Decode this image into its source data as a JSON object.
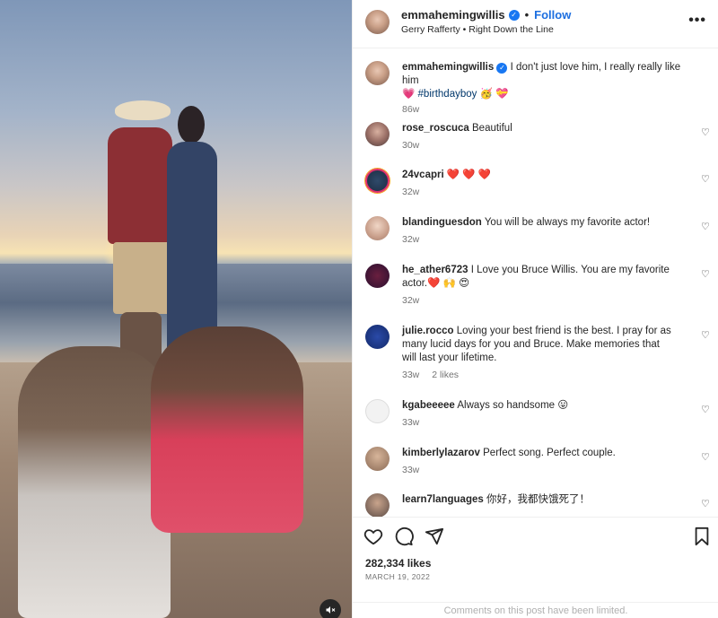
{
  "post": {
    "username": "emmahemingwillis",
    "follow_label": "Follow",
    "audio": "Gerry Rafferty • Right Down the Line",
    "mute_icon": "speaker-muted-icon",
    "caption": {
      "username": "emmahemingwillis",
      "text": "I don't just love him, I really really like him",
      "line2_tag": "#birthdayboy",
      "age": "86w"
    }
  },
  "comments": [
    {
      "username": "rose_roscuca",
      "text": "Beautiful",
      "age": "30w"
    },
    {
      "username": "24vcapri",
      "text": "❤️ ❤️ ❤️",
      "age": "32w"
    },
    {
      "username": "blandinguesdon",
      "text": "You will be always my favorite actor!",
      "age": "32w"
    },
    {
      "username": "he_ather6723",
      "text": "I Love you Bruce Willis. You are my favorite actor.❤️ 🙌 😍",
      "age": "32w"
    },
    {
      "username": "julie.rocco",
      "text": "Loving your best friend is the best. I pray for as many lucid days for you and Bruce. Make memories that will last your lifetime.",
      "age": "33w",
      "likes": "2 likes"
    },
    {
      "username": "kgabeeeee",
      "text": "Always so handsome 😛",
      "age": "33w"
    },
    {
      "username": "kimberlylazarov",
      "text": "Perfect song. Perfect couple.",
      "age": "33w"
    },
    {
      "username": "learn7languages",
      "text": "你好，我都快饿死了！",
      "age": ""
    }
  ],
  "footer": {
    "likes": "282,334 likes",
    "date": "MARCH 19, 2022",
    "comments_limited": "Comments on this post have been limited."
  },
  "colors": {
    "link_blue": "#1d6fe0",
    "verified_blue": "#1877f2",
    "secondary_text": "#737373"
  },
  "icons": [
    "heart-icon",
    "comment-icon",
    "share-icon",
    "bookmark-icon",
    "more-options-icon",
    "verified-badge-icon"
  ]
}
